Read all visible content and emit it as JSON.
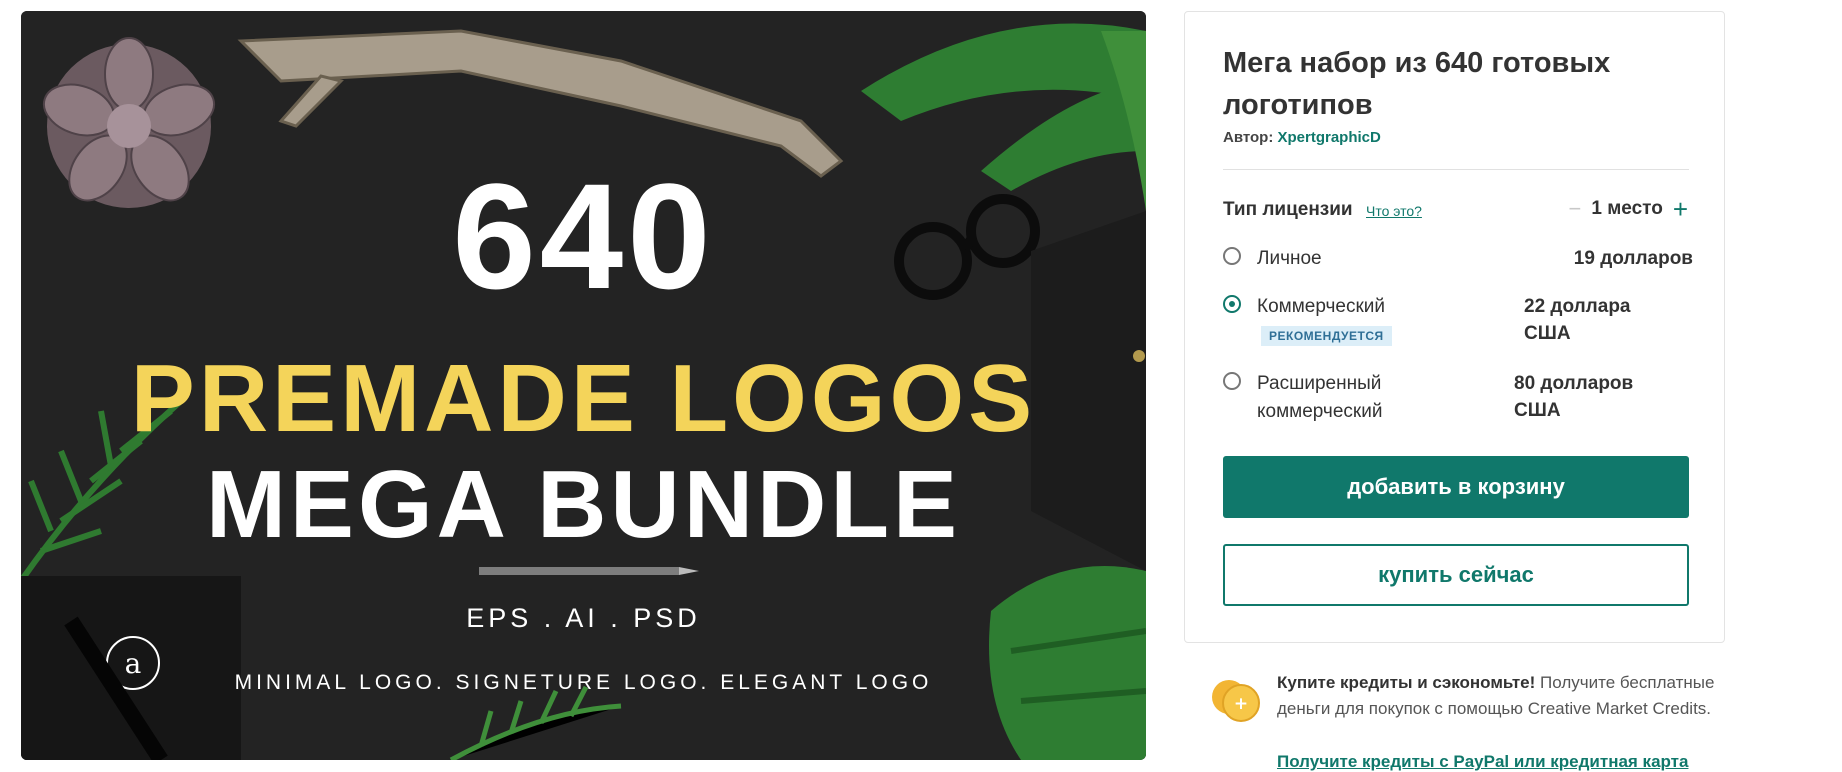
{
  "hero": {
    "number": "640",
    "line1": "PREMADE LOGOS",
    "line2": "MEGA BUNDLE",
    "formats": "EPS . AI . PSD",
    "styles": "MINIMAL LOGO. SIGNETURE LOGO. ELEGANT LOGO",
    "card_letter": "a",
    "colors": {
      "background": "#232323",
      "accent_yellow": "#f4d45a",
      "leaf_green": "#2e7d32"
    }
  },
  "product": {
    "title": "Мега набор из 640 готовых логотипов",
    "author_label": "Автор:",
    "author_name": "XpertgraphicD"
  },
  "license": {
    "label": "Тип лицензии",
    "help_link": "Что это?",
    "seat_minus": "−",
    "seats": "1 место",
    "seat_plus": "+",
    "options": [
      {
        "name": "Личное",
        "price": "19 долларов",
        "selected": false,
        "badge": ""
      },
      {
        "name": "Коммерческий",
        "price": "22 доллара США",
        "selected": true,
        "badge": "РЕКОМЕНДУЕТСЯ"
      },
      {
        "name": "Расширенный коммерческий",
        "price": "80 долларов США",
        "selected": false,
        "badge": ""
      }
    ]
  },
  "actions": {
    "add_to_cart": "добавить в корзину",
    "buy_now": "купить сейчас"
  },
  "promo": {
    "headline": "Купите кредиты и сэкономьте!",
    "body": " Получите бесплатные деньги для покупок с помощью Creative Market Credits.",
    "link": "Получите кредиты с PayPal или кредитная карта",
    "icon": "coins-icon"
  },
  "theme": {
    "accent": "#10786b",
    "badge_bg": "#dceef8",
    "badge_fg": "#2f6f96"
  }
}
